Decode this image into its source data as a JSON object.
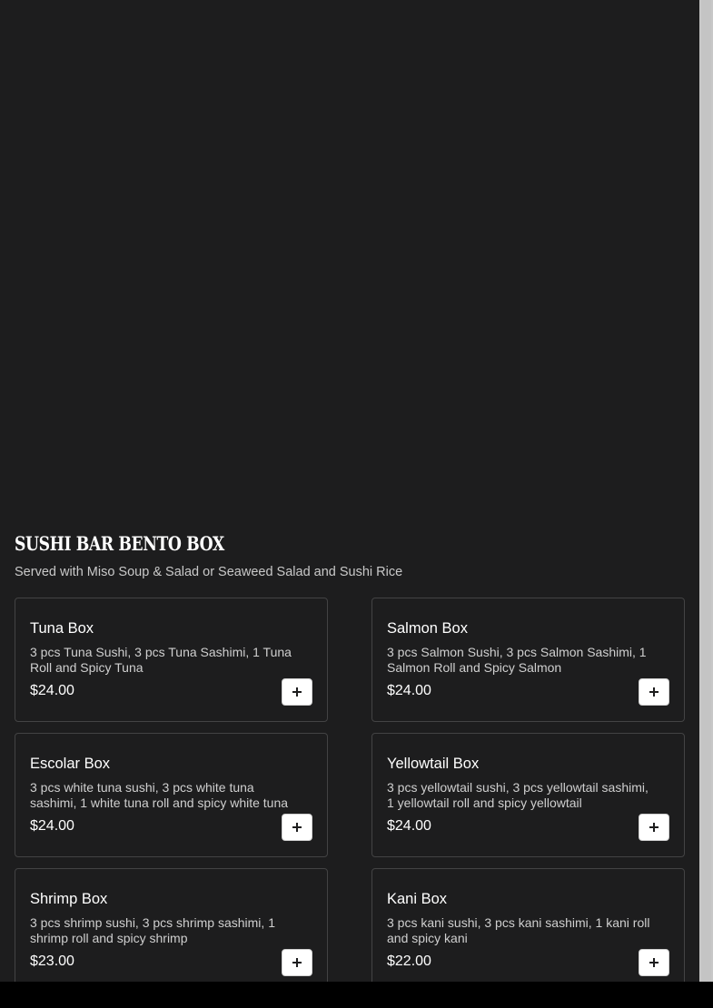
{
  "section": {
    "title": "Sushi Bar Bento Box",
    "subtitle": "Served with Miso Soup & Salad or Seaweed Salad and Sushi Rice"
  },
  "items": [
    {
      "name": "Tuna Box",
      "description": "3 pcs Tuna Sushi, 3 pcs Tuna Sashimi, 1 Tuna Roll and Spicy Tuna",
      "price": "$24.00",
      "add_icon": "plus-icon"
    },
    {
      "name": "Salmon Box",
      "description": "3 pcs Salmon Sushi, 3 pcs Salmon Sashimi, 1 Salmon Roll and Spicy Salmon",
      "price": "$24.00",
      "add_icon": "plus-icon"
    },
    {
      "name": "Escolar Box",
      "description": "3 pcs white tuna sushi, 3 pcs white tuna sashimi, 1 white tuna roll and spicy white tuna",
      "price": "$24.00",
      "add_icon": "plus-icon"
    },
    {
      "name": "Yellowtail Box",
      "description": "3 pcs yellowtail sushi, 3 pcs yellowtail sashimi, 1 yellowtail roll and spicy yellowtail",
      "price": "$24.00",
      "add_icon": "plus-icon"
    },
    {
      "name": "Shrimp Box",
      "description": "3 pcs shrimp sushi, 3 pcs shrimp sashimi, 1 shrimp roll and spicy shrimp",
      "price": "$23.00",
      "add_icon": "plus-icon"
    },
    {
      "name": "Kani Box",
      "description": "3 pcs kani sushi, 3 pcs kani sashimi, 1 kani roll and spicy kani",
      "price": "$22.00",
      "add_icon": "plus-icon"
    }
  ],
  "colors": {
    "background": "#1d1d1e",
    "card_border": "#434344",
    "text_primary": "#ffffff",
    "text_secondary": "#c9c9c9",
    "button_background": "#ffffff"
  }
}
